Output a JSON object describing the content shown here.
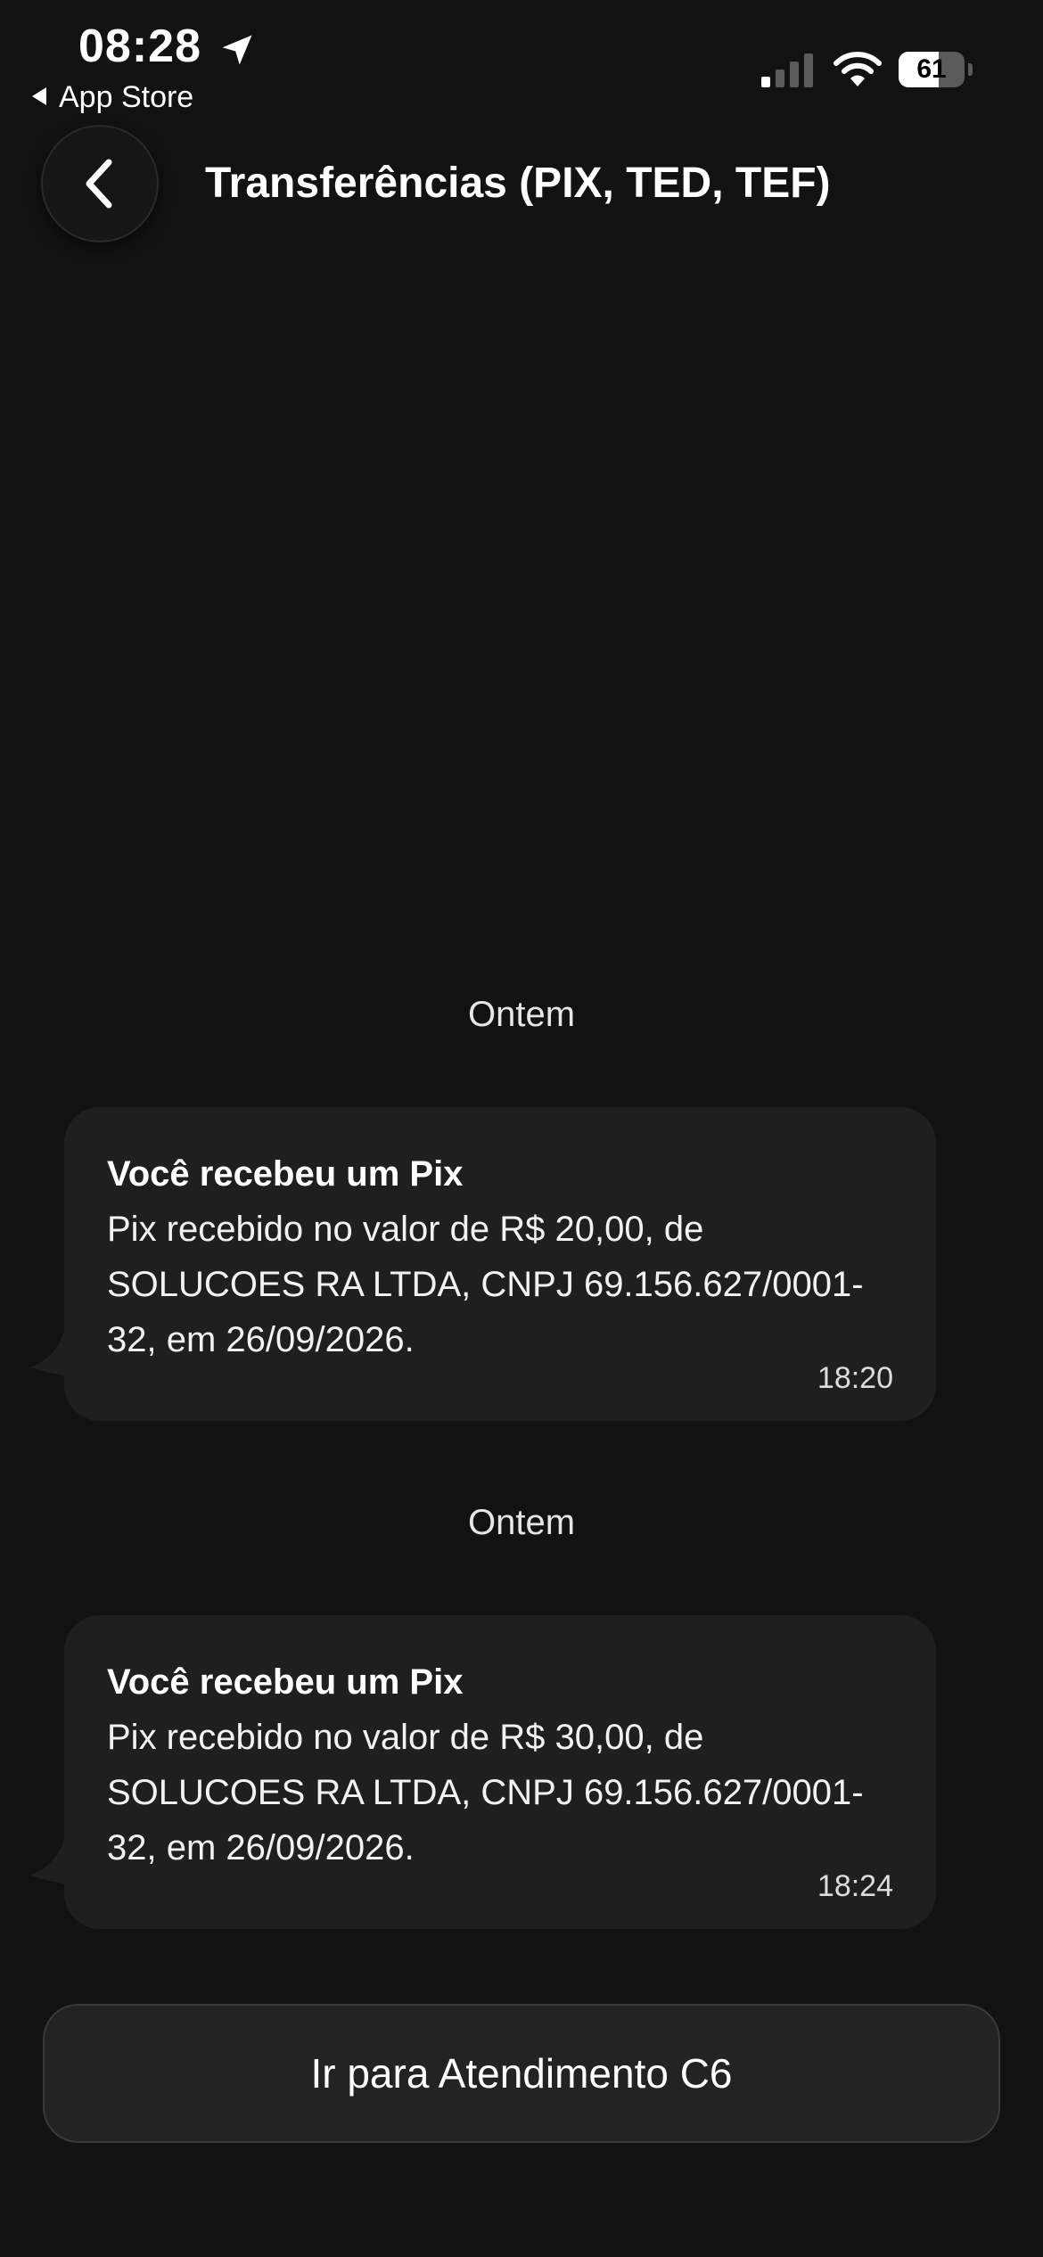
{
  "status_bar": {
    "time": "08:28",
    "back_app_label": "App Store",
    "battery_level": "61",
    "battery_fraction": 0.61
  },
  "header": {
    "title": "Transferências (PIX, TED, TEF)"
  },
  "messages": [
    {
      "date_label": "Ontem",
      "title": "Você recebeu um Pix",
      "body": "Pix recebido no valor de R$ 20,00, de SOLUCOES RA LTDA, CNPJ 69.156.627/0001-32, em 26/09/2026.",
      "time": "18:20"
    },
    {
      "date_label": "Ontem",
      "title": "Você recebeu um Pix",
      "body": "Pix recebido no valor de R$ 30,00, de SOLUCOES RA LTDA, CNPJ 69.156.627/0001-32, em 26/09/2026.",
      "time": "18:24"
    }
  ],
  "footer": {
    "cta_label": "Ir para Atendimento C6"
  },
  "colors": {
    "background": "#121212",
    "bubble": "#1f1f1f",
    "button": "#232323"
  },
  "icons": {
    "location": "location-arrow-icon",
    "signal": "cellular-signal-icon",
    "wifi": "wifi-icon",
    "battery": "battery-icon",
    "back": "chevron-left-icon"
  }
}
